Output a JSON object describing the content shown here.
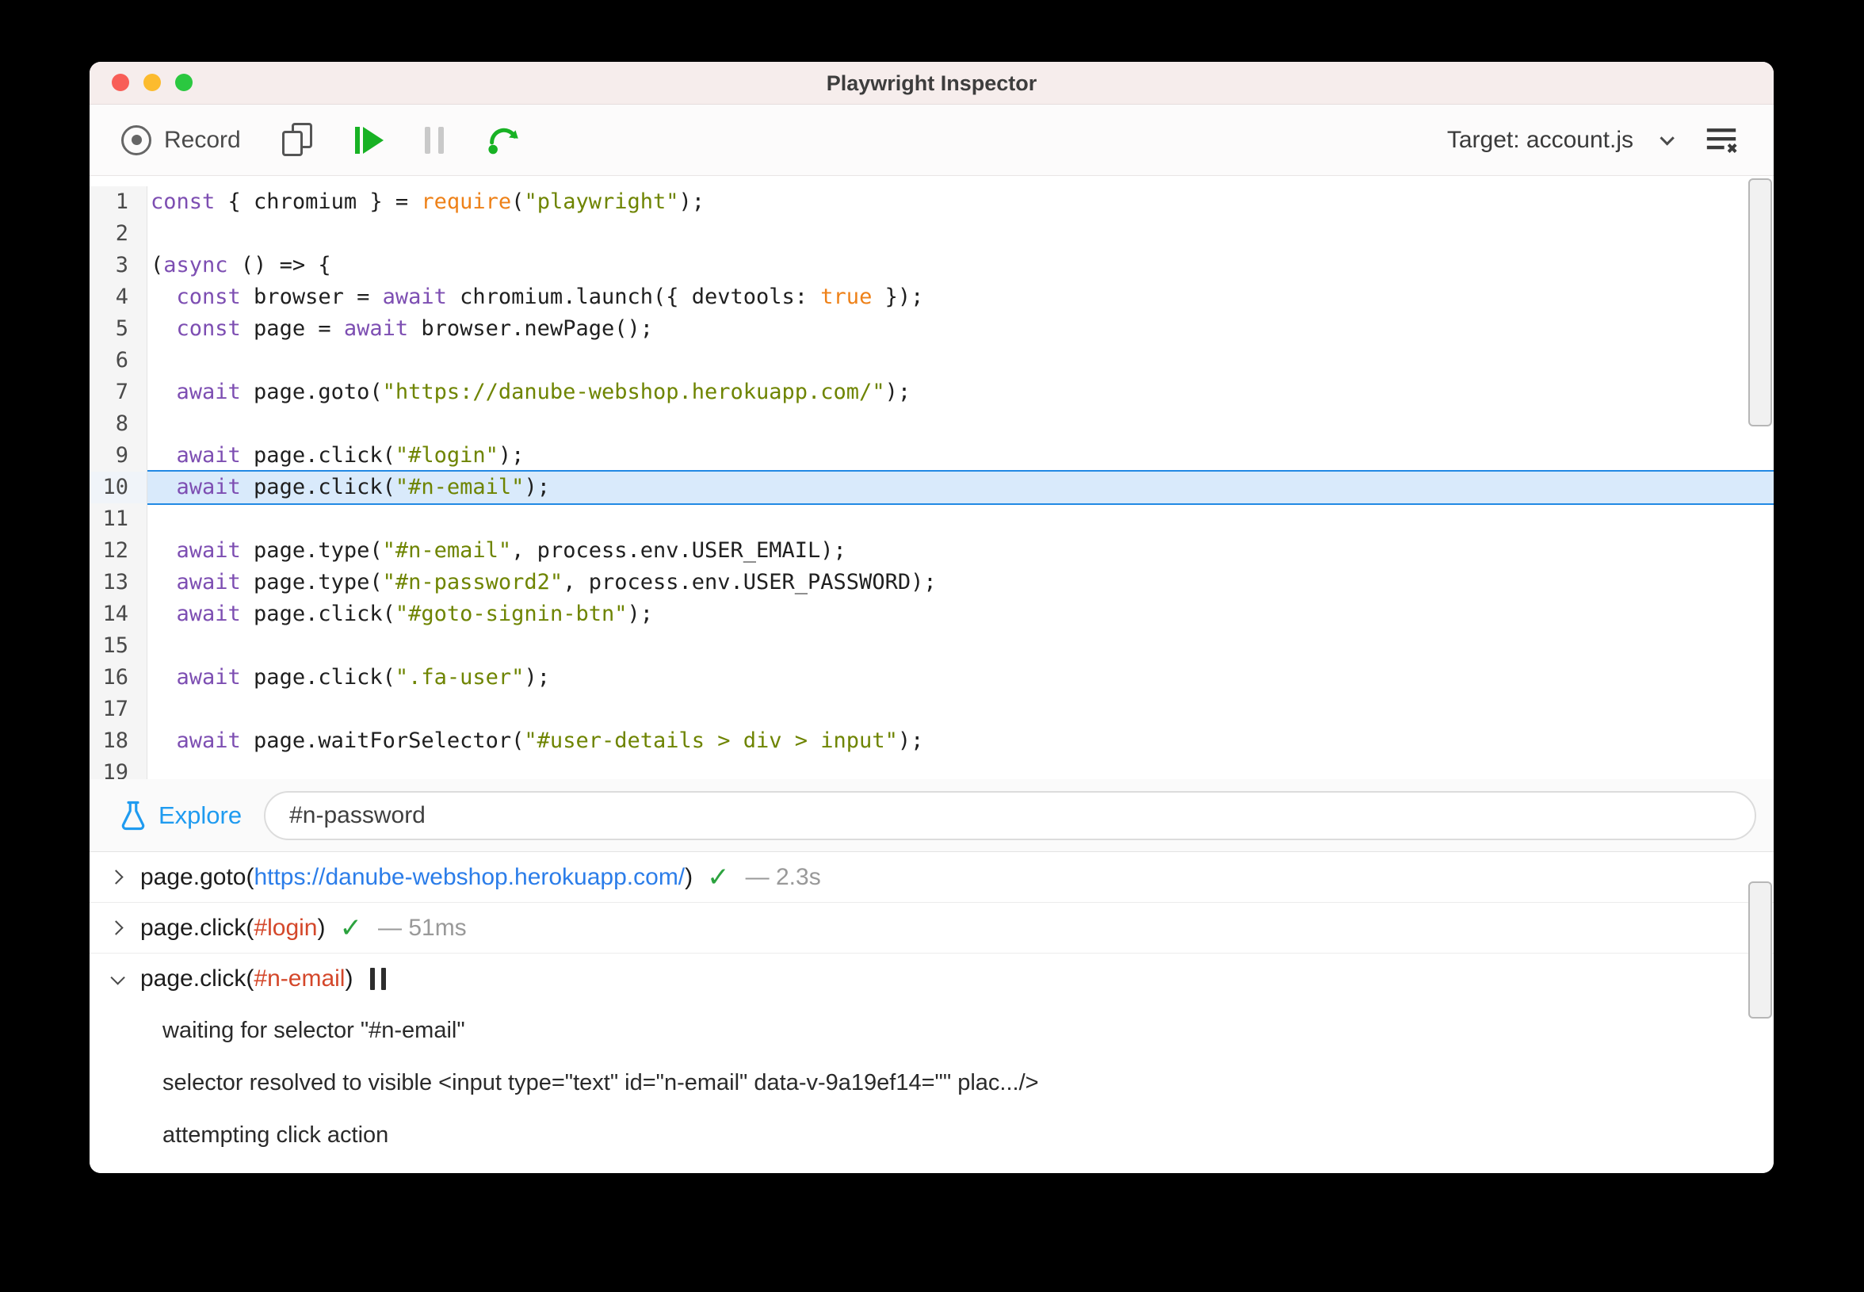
{
  "window": {
    "title": "Playwright Inspector"
  },
  "toolbar": {
    "record_label": "Record",
    "target_label": "Target: account.js"
  },
  "colors": {
    "titlebar_bg": "#f6edec",
    "accent_green": "#18b224",
    "keyword_purple": "#7d4eb2",
    "function_orange": "#ee8118",
    "string_olive": "#6e8400",
    "highlight_bg": "#d9eafb",
    "highlight_border": "#2289e4",
    "link_blue": "#2b7de9",
    "selector_red": "#d4472a",
    "success_green": "#2ca33f",
    "explore_blue": "#1f9bf0"
  },
  "editor": {
    "highlight_line": 10,
    "lines": [
      {
        "n": 1,
        "tokens": [
          [
            "k",
            "const"
          ],
          [
            "d",
            " { chromium } = "
          ],
          [
            "f",
            "require"
          ],
          [
            "d",
            "("
          ],
          [
            "s",
            "\"playwright\""
          ],
          [
            "d",
            ");"
          ]
        ]
      },
      {
        "n": 2,
        "tokens": []
      },
      {
        "n": 3,
        "tokens": [
          [
            "d",
            "("
          ],
          [
            "k",
            "async"
          ],
          [
            "d",
            " () => {"
          ]
        ]
      },
      {
        "n": 4,
        "tokens": [
          [
            "d",
            "  "
          ],
          [
            "k",
            "const"
          ],
          [
            "d",
            " browser = "
          ],
          [
            "k",
            "await"
          ],
          [
            "d",
            " chromium.launch({ devtools: "
          ],
          [
            "a",
            "true"
          ],
          [
            "d",
            " });"
          ]
        ]
      },
      {
        "n": 5,
        "tokens": [
          [
            "d",
            "  "
          ],
          [
            "k",
            "const"
          ],
          [
            "d",
            " page = "
          ],
          [
            "k",
            "await"
          ],
          [
            "d",
            " browser.newPage();"
          ]
        ]
      },
      {
        "n": 6,
        "tokens": []
      },
      {
        "n": 7,
        "tokens": [
          [
            "d",
            "  "
          ],
          [
            "k",
            "await"
          ],
          [
            "d",
            " page.goto("
          ],
          [
            "s",
            "\"https://danube-webshop.herokuapp.com/\""
          ],
          [
            "d",
            ");"
          ]
        ]
      },
      {
        "n": 8,
        "tokens": []
      },
      {
        "n": 9,
        "tokens": [
          [
            "d",
            "  "
          ],
          [
            "k",
            "await"
          ],
          [
            "d",
            " page.click("
          ],
          [
            "s",
            "\"#login\""
          ],
          [
            "d",
            ");"
          ]
        ]
      },
      {
        "n": 10,
        "tokens": [
          [
            "d",
            "  "
          ],
          [
            "k",
            "await"
          ],
          [
            "d",
            " page.click("
          ],
          [
            "s",
            "\"#n-email\""
          ],
          [
            "d",
            ");"
          ]
        ]
      },
      {
        "n": 11,
        "tokens": []
      },
      {
        "n": 12,
        "tokens": [
          [
            "d",
            "  "
          ],
          [
            "k",
            "await"
          ],
          [
            "d",
            " page.type("
          ],
          [
            "s",
            "\"#n-email\""
          ],
          [
            "d",
            ", process.env.USER_EMAIL);"
          ]
        ]
      },
      {
        "n": 13,
        "tokens": [
          [
            "d",
            "  "
          ],
          [
            "k",
            "await"
          ],
          [
            "d",
            " page.type("
          ],
          [
            "s",
            "\"#n-password2\""
          ],
          [
            "d",
            ", process.env.USER_PASSWORD);"
          ]
        ]
      },
      {
        "n": 14,
        "tokens": [
          [
            "d",
            "  "
          ],
          [
            "k",
            "await"
          ],
          [
            "d",
            " page.click("
          ],
          [
            "s",
            "\"#goto-signin-btn\""
          ],
          [
            "d",
            ");"
          ]
        ]
      },
      {
        "n": 15,
        "tokens": []
      },
      {
        "n": 16,
        "tokens": [
          [
            "d",
            "  "
          ],
          [
            "k",
            "await"
          ],
          [
            "d",
            " page.click("
          ],
          [
            "s",
            "\".fa-user\""
          ],
          [
            "d",
            ");"
          ]
        ]
      },
      {
        "n": 17,
        "tokens": []
      },
      {
        "n": 18,
        "tokens": [
          [
            "d",
            "  "
          ],
          [
            "k",
            "await"
          ],
          [
            "d",
            " page.waitForSelector("
          ],
          [
            "s",
            "\"#user-details > div > input\""
          ],
          [
            "d",
            ");"
          ]
        ]
      },
      {
        "n": 19,
        "tokens": []
      }
    ]
  },
  "explore": {
    "label": "Explore",
    "input_value": "#n-password"
  },
  "log": {
    "rows": [
      {
        "expanded": false,
        "segments": [
          {
            "type": "plain",
            "text": "page.goto("
          },
          {
            "type": "link",
            "text": "https://danube-webshop.herokuapp.com/"
          },
          {
            "type": "plain",
            "text": ")"
          }
        ],
        "status": "success",
        "timing": "— 2.3s"
      },
      {
        "expanded": false,
        "segments": [
          {
            "type": "plain",
            "text": "page.click("
          },
          {
            "type": "sel",
            "text": "#login"
          },
          {
            "type": "plain",
            "text": ")"
          }
        ],
        "status": "success",
        "timing": "— 51ms"
      },
      {
        "expanded": true,
        "segments": [
          {
            "type": "plain",
            "text": "page.click("
          },
          {
            "type": "sel",
            "text": "#n-email"
          },
          {
            "type": "plain",
            "text": ")"
          }
        ],
        "status": "paused",
        "timing": ""
      }
    ],
    "details": [
      "waiting for selector \"#n-email\"",
      "selector resolved to visible <input type=\"text\" id=\"n-email\" data-v-9a19ef14=\"\" plac.../>",
      "attempting click action"
    ]
  }
}
